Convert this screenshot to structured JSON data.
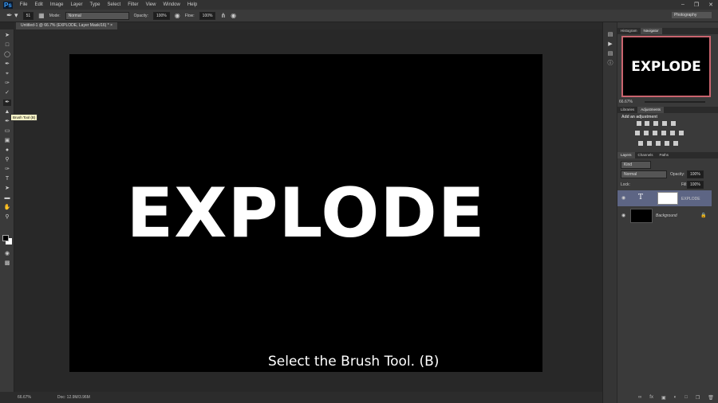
{
  "menu": {
    "logo": "Ps",
    "items": [
      "File",
      "Edit",
      "Image",
      "Layer",
      "Type",
      "Select",
      "Filter",
      "View",
      "Window",
      "Help"
    ]
  },
  "options": {
    "brush_size": "51",
    "mode_label": "Mode:",
    "mode": "Normal",
    "opacity_label": "Opacity:",
    "opacity": "100%",
    "flow_label": "Flow:",
    "flow": "100%"
  },
  "workspace": "Photography",
  "document_tab": "Untitled-1 @ 66.7% (EXPLODE, Layer Mask/16) *",
  "tooltip": "Brush Tool (B)",
  "canvas_text": "EXPLODE",
  "subtitle": "Select the Brush Tool. (B)",
  "status": {
    "zoom": "66.67%",
    "doc": "Doc: 12.9M/3.96M"
  },
  "panels": {
    "nav_tabs": [
      "Histogram",
      "Navigator"
    ],
    "nav_zoom": "66.67%",
    "nav_text": "EXPLODE",
    "adj_tabs": [
      "Libraries",
      "Adjustments"
    ],
    "adj_title": "Add an adjustment",
    "layer_tabs": [
      "Layers",
      "Channels",
      "Paths"
    ],
    "kind": "Kind",
    "blend": "Normal",
    "opacity_label": "Opacity:",
    "opacity": "100%",
    "lock_label": "Lock:",
    "fill_label": "Fill:",
    "fill": "100%",
    "layers": [
      {
        "name": "EXPLODE",
        "type": "T"
      },
      {
        "name": "Background"
      }
    ]
  }
}
